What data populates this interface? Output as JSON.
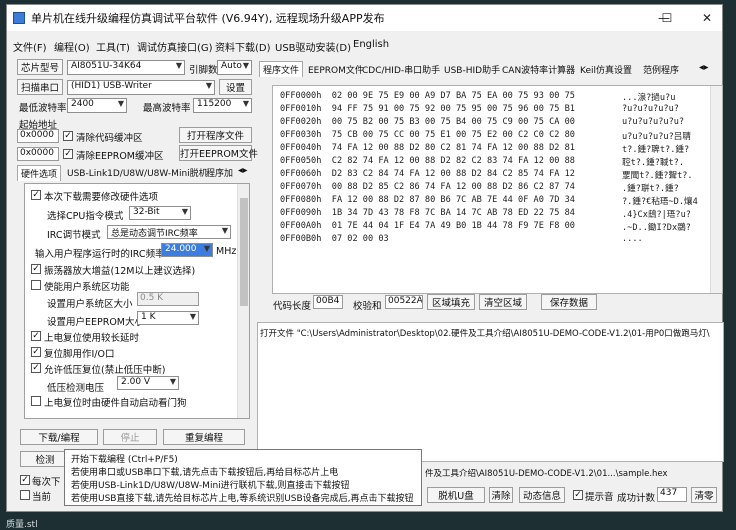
{
  "window": {
    "title": "单片机在线升级编程仿真调试平台软件 (V6.94Y), 远程现场升级APP发布",
    "minimize": "—",
    "maximize": "☐",
    "close": "✕"
  },
  "menu": [
    "文件(F)",
    "编程(O)",
    "工具(T)",
    "调试仿真接口(G)",
    "资料下载(D)",
    "USB驱动安装(D)",
    "English"
  ],
  "left": {
    "chip_label": "芯片型号",
    "chip_value": "AI8051U-34K64",
    "pin_label": "引脚数",
    "pin_value": "Auto",
    "scan_label": "扫描串口",
    "port_value": "(HID1) USB-Writer",
    "settings_label": "设置",
    "min_baud_label": "最低波特率",
    "min_baud": "2400",
    "max_baud_label": "最高波特率",
    "max_baud": "115200",
    "start_addr_label": "起始地址",
    "addr1": "0x0000",
    "clear_code_label": "清除代码缓冲区",
    "open_prog_label": "打开程序文件",
    "addr2": "0x0000",
    "clear_eeprom_label": "清除EEPROM缓冲区",
    "open_eeprom_label": "打开EEPROM文件",
    "tabs": [
      "硬件选项",
      "USB-Link1D/U8W/U8W-Mini脱机",
      "程序加"
    ],
    "opt_reload": "本次下载需要修改硬件选项",
    "cpu_mode_label": "选择CPU指令模式",
    "cpu_mode": "32-Bit",
    "irc_mode_label": "IRC调节模式",
    "irc_mode": "总是动态调节IRC频率",
    "freq_label": "输入用户程序运行时的IRC频率",
    "freq_value": "24.000",
    "freq_unit": "MHz",
    "opt_osc": "振荡器放大增益(12M以上建议选择)",
    "opt_user_eeprom": "使能用户系统区功能",
    "user_sys_size_label": "设置用户系统区大小",
    "user_sys_size": "0.5 K",
    "user_eeprom_size_label": "设置用户EEPROM大小",
    "user_eeprom_size": "1 K",
    "opt_reset_long": "上电复位使用较长延时",
    "opt_reset_pin": "复位脚用作I/O口",
    "opt_lvd": "允许低压复位(禁止低压中断)",
    "lvd_label": "低压检测电压",
    "lvd_value": "2.00 V",
    "opt_wdt": "上电复位时由硬件自动启动看门狗",
    "download_label": "下载/编程",
    "stop_label": "停止",
    "reprogram_label": "重复编程",
    "detect_label": "检测",
    "each_label": "每次下",
    "current_label": "当前"
  },
  "right": {
    "tabs": [
      "程序文件",
      "EEPROM文件",
      "CDC/HID-串口助手",
      "USB-HID助手",
      "CAN波特率计算器",
      "Keil仿真设置",
      "范例程序"
    ],
    "hex_rows": [
      {
        "addr": "0FF0000h",
        "bytes": "02 00 9E 75 E9 00 A9 D7 BA 75 EA 00 75 93 00 75",
        "ascii": "...湶?撾u?u"
      },
      {
        "addr": "0FF0010h",
        "bytes": "94 FF 75 91 00 75 92 00 75 95 00 75 96 00 75 B1",
        "ascii": "?u?u?u?u?u?"
      },
      {
        "addr": "0FF0020h",
        "bytes": "00 75 B2 00 75 B3 00 75 B4 00 75 C9 00 75 CA 00",
        "ascii": "u?u?u?u?u?u?"
      },
      {
        "addr": "0FF0030h",
        "bytes": "75 CB 00 75 CC 00 75 E1 00 75 E2 00 C2 C0 C2 80",
        "ascii": "u?u?u?u?u?吕聙"
      },
      {
        "addr": "0FF0040h",
        "bytes": "74 FA 12 00 88 D2 80 C2 81 74 FA 12 00 88 D2 81",
        "ascii": "t?.鍾?聛t?.鍾?"
      },
      {
        "addr": "0FF0050h",
        "bytes": "C2 82 74 FA 12 00 88 D2 82 C2 83 74 FA 12 00 88",
        "ascii": "聜t?.鍾?聝t?."
      },
      {
        "addr": "0FF0060h",
        "bytes": "D2 83 C2 84 74 FA 12 00 88 D2 84 C2 85 74 FA 12",
        "ascii": "覂聞t?.鍾?聟t?."
      },
      {
        "addr": "0FF0070h",
        "bytes": "00 88 D2 85 C2 86 74 FA 12 00 88 D2 86 C2 87 74",
        "ascii": ".鍾?聠t?.鍾?"
      },
      {
        "addr": "0FF0080h",
        "bytes": "FA 12 00 88 D2 87 80 B6 7C AB 7E 44 0F A0 7D 34",
        "ascii": "?.鍾?€秥珸~D.爙4"
      },
      {
        "addr": "0FF0090h",
        "bytes": "1B 34 7D 43 78 F8 7C BA 14 7C AB 78 ED 22 75 84",
        "ascii": ".4}Cx鴟?|珸?u?"
      },
      {
        "addr": "0FF00A0h",
        "bytes": "01 7E 44 04 1F E4 7A 49 B0 1B 44 78 F9 7E F8 00",
        "ascii": ".~D..鋤I?Dx鵽?"
      },
      {
        "addr": "0FF00B0h",
        "bytes": "07 02 00 03",
        "ascii": "...."
      }
    ],
    "code_len_label": "代码长度",
    "code_len": "00B4",
    "checksum_label": "校验和",
    "checksum": "00522A",
    "fill_label": "区域填充",
    "clear_label": "清空区域",
    "save_label": "保存数据",
    "log_line": "打开文件 \"C:\\Users\\Administrator\\Desktop\\02.硬件及工具介绍\\AI8051U-DEMO-CODE-V1.2\\01-用P0口做跑马灯\\",
    "status_path": "件及工具介绍\\AI8051U-DEMO-CODE-V1.2\\01...\\sample.hex",
    "set_disk_label": "脱机U盘",
    "clear_btn": "清除",
    "dyn_label": "动态信息",
    "beep_label": "提示音",
    "success_label": "成功计数",
    "success_count": "437",
    "clear2": "清零"
  },
  "tooltip": {
    "line1": "开始下载编程 (Ctrl+P/F5)",
    "line2": "若使用串口或USB串口下载,请先点击下载按钮后,再给目标芯片上电",
    "line3": "若使用USB-Link1D/U8W/U8W-Mini进行联机下载,则直接击下载按钮",
    "line4": "若使用USB直接下载,请先给目标芯片上电,等系统识别USB设备完成后,再点击下载按钮"
  },
  "taskbar_label": "质量.stl"
}
